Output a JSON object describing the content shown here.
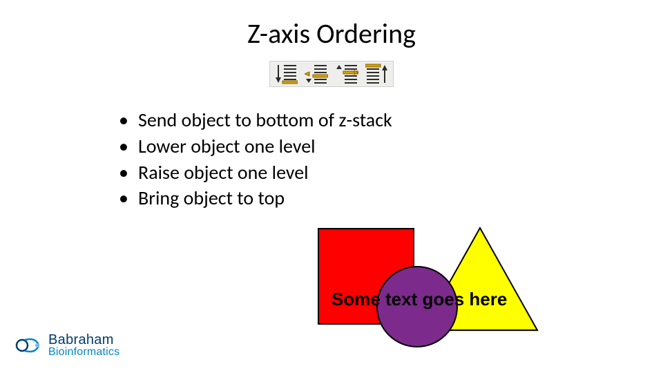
{
  "title": "Z-axis Ordering",
  "toolbar": {
    "icons": [
      {
        "name": "send-to-bottom-icon"
      },
      {
        "name": "lower-one-level-icon"
      },
      {
        "name": "raise-one-level-icon"
      },
      {
        "name": "bring-to-top-icon"
      }
    ]
  },
  "bullets": [
    "Send object to bottom of z-stack",
    "Lower object one level",
    "Raise object one level",
    "Bring object to top"
  ],
  "shapes": {
    "overlay_text": "Some text goes here",
    "red": "#ff0000",
    "yellow": "#ffff00",
    "purple": "#7c2a8c"
  },
  "logo": {
    "line1": "Babraham",
    "line2": "Bioinformatics"
  }
}
